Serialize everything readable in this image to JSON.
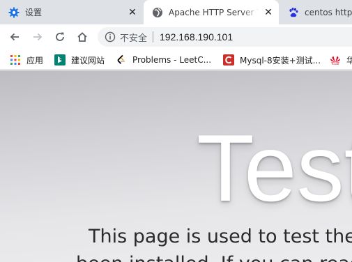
{
  "tabs": [
    {
      "title": "设置",
      "icon": "gear-icon",
      "active": false
    },
    {
      "title": "Apache HTTP Server Test Page",
      "icon": "globe-icon",
      "active": true
    },
    {
      "title": "centos httpd",
      "icon": "baidu-paw-icon",
      "active": false
    }
  ],
  "omnibox": {
    "security_label": "不安全",
    "url": "192.168.190.101"
  },
  "bookmarks": [
    {
      "label": "应用",
      "icon": "apps-grid-icon"
    },
    {
      "label": "建议网站",
      "icon": "bing-icon"
    },
    {
      "label": "Problems - LeetC...",
      "icon": "leetcode-icon"
    },
    {
      "label": "Mysql-8安装+测试...",
      "icon": "csdn-icon"
    },
    {
      "label": "华",
      "icon": "huawei-icon"
    }
  ],
  "page": {
    "heading": "Test",
    "line1": "This page is used to test the p",
    "line2": "been installed. If you can read"
  },
  "colors": {
    "tabstrip": "#dee1e6",
    "omnibox": "#f1f3f4",
    "csdn_red": "#c9302c",
    "huawei_red": "#e3001b",
    "bing_teal": "#008373",
    "chrome_blue": "#1a73e8"
  }
}
